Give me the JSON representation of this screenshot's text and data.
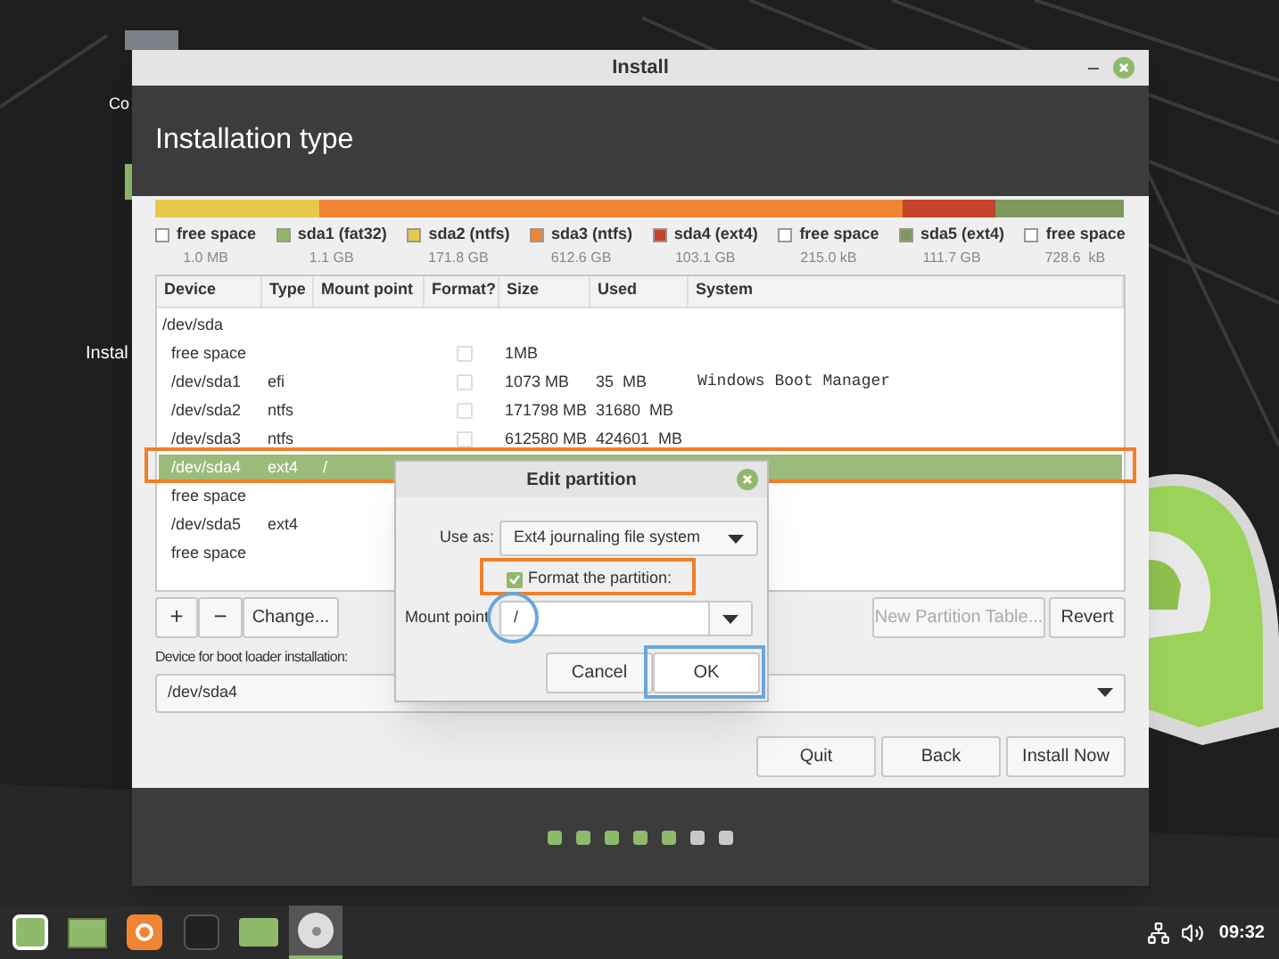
{
  "desktop_icons": [
    {
      "label": "Co"
    },
    {
      "label": "Instal"
    }
  ],
  "window": {
    "title": "Install",
    "heading": "Installation type"
  },
  "legend": [
    {
      "label": "free space",
      "size": "1.0 MB",
      "color": "#ffffff"
    },
    {
      "label": "sda1 (fat32)",
      "size": "1.1 GB",
      "color": "#8fb96b"
    },
    {
      "label": "sda2 (ntfs)",
      "size": "171.8 GB",
      "color": "#e8c84a"
    },
    {
      "label": "sda3 (ntfs)",
      "size": "612.6 GB",
      "color": "#ef8533"
    },
    {
      "label": "sda4 (ext4)",
      "size": "103.1 GB",
      "color": "#c4432a"
    },
    {
      "label": "free space",
      "size": "215.0 kB",
      "color": "#ffffff"
    },
    {
      "label": "sda5 (ext4)",
      "size": "111.7 GB",
      "color": "#7d9a5c"
    },
    {
      "label": "free space",
      "size": "728.6  kB",
      "color": "#ffffff"
    }
  ],
  "table": {
    "columns": [
      "Device",
      "Type",
      "Mount point",
      "Format?",
      "Size",
      "Used",
      "System"
    ],
    "rows": [
      {
        "device": "/dev/sda",
        "selected": false,
        "children": [
          {
            "device": "free space",
            "format": false,
            "size": "1MB",
            "selected": false
          },
          {
            "device": "/dev/sda1",
            "type": "efi",
            "format": false,
            "size": "1073 MB",
            "used": "35  MB",
            "system": "Windows Boot Manager",
            "selected": false
          },
          {
            "device": "/dev/sda2",
            "type": "ntfs",
            "format": false,
            "size": "171798 MB",
            "used": "31680  MB",
            "selected": false
          },
          {
            "device": "/dev/sda3",
            "type": "ntfs",
            "format": false,
            "size": "612580 MB",
            "used": "424601  MB",
            "selected": false
          },
          {
            "device": "/dev/sda4",
            "type": "ext4",
            "mount": "/",
            "selected": true
          },
          {
            "device": "free space",
            "selected": false
          },
          {
            "device": "/dev/sda5",
            "type": "ext4",
            "selected": false
          },
          {
            "device": "free space",
            "selected": false
          }
        ]
      }
    ]
  },
  "table_buttons": {
    "add": "+",
    "remove": "−",
    "change": "Change...",
    "new_table": {
      "label": "New Partition Table...",
      "disabled": true
    },
    "revert": "Revert"
  },
  "bootloader": {
    "label": "Device for boot loader installation:",
    "value": "/dev/sda4"
  },
  "actions": [
    "Quit",
    "Back",
    "Install Now"
  ],
  "dialog": {
    "title": "Edit partition",
    "use_as_label": "Use as:",
    "use_as_value": "Ext4 journaling file system",
    "format_label": "Format the partition:",
    "format_checked": true,
    "mount_label": "Mount point",
    "mount_value": "/",
    "cancel": "Cancel",
    "ok": "OK"
  },
  "steps": [
    {
      "done": true
    },
    {
      "done": true
    },
    {
      "done": true
    },
    {
      "done": true
    },
    {
      "done": true
    },
    {
      "done": false
    },
    {
      "done": false
    }
  ],
  "taskbar": {
    "apps": [
      {
        "kind": "menu",
        "active": false
      },
      {
        "kind": "desktop",
        "active": false
      },
      {
        "kind": "browser",
        "active": false
      },
      {
        "kind": "terminal",
        "active": false
      },
      {
        "kind": "files",
        "active": false
      },
      {
        "kind": "disc",
        "active": true
      }
    ],
    "clock": "09:32"
  }
}
